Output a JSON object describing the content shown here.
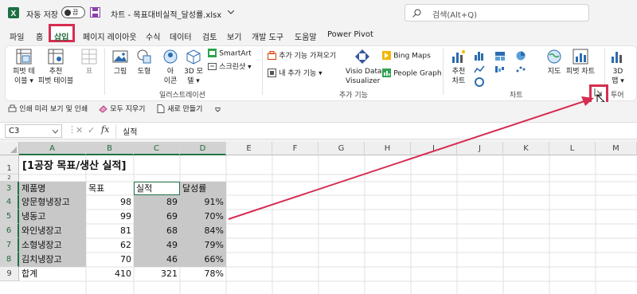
{
  "titlebar": {
    "autosave_label": "자동 저장",
    "autosave_state": "끔",
    "filename": "차트 - 목표대비실적_달성률.xlsx",
    "search_placeholder": "검색(Alt+Q)"
  },
  "menu": [
    "파일",
    "홈",
    "삽입",
    "페이지 레이아웃",
    "수식",
    "데이터",
    "검토",
    "보기",
    "개발 도구",
    "도움말",
    "Power Pivot"
  ],
  "ribbon": {
    "pivot_table": [
      "피벗 테",
      "이블 ▾"
    ],
    "recommended_pivot": [
      "추천",
      "피벗 테이블"
    ],
    "table": "표",
    "picture": "그림",
    "shapes": "도형",
    "icons": [
      "아",
      "이콘"
    ],
    "models3d": [
      "3D 모",
      "델 ▾"
    ],
    "smartart": "SmartArt",
    "screenshot": "스크린샷 ▾",
    "illustrations_group": "일러스트레이션",
    "get_addins": "추가 기능 가져오기",
    "my_addins": "내 추가 기능 ▾",
    "visio": [
      "Visio Data",
      "Visualizer"
    ],
    "bing_maps": "Bing Maps",
    "people_graph": "People Graph",
    "addins_group": "추가 기능",
    "recommended_charts": [
      "추천",
      "차트"
    ],
    "maps": "지도",
    "pivot_chart": "피벗 차트",
    "charts_group": "차트",
    "map3d": [
      "3D",
      "맵 ▾"
    ],
    "tours_group": "투어"
  },
  "qat": {
    "print_preview": "인쇄 미리 보기 및 인쇄",
    "clear_all": "모두 지우기",
    "new": "새로 만들기"
  },
  "formula_bar": {
    "name_box": "C3",
    "fx": "fx",
    "content": "실적"
  },
  "grid": {
    "columns": [
      "A",
      "B",
      "C",
      "D",
      "E",
      "F",
      "G",
      "H",
      "I",
      "J",
      "K",
      "L",
      "M"
    ],
    "rows": [
      "1",
      "2",
      "3",
      "4",
      "5",
      "6",
      "7",
      "8",
      "9"
    ],
    "title": "[1공장 목표/생산 실적]",
    "headers": [
      "제품명",
      "목표",
      "실적",
      "달성률"
    ],
    "data": [
      [
        "양문형냉장고",
        "98",
        "89",
        "91%"
      ],
      [
        "냉동고",
        "99",
        "69",
        "70%"
      ],
      [
        "와인냉장고",
        "81",
        "68",
        "84%"
      ],
      [
        "소형냉장고",
        "62",
        "49",
        "79%"
      ],
      [
        "김치냉장고",
        "70",
        "46",
        "66%"
      ]
    ],
    "total": [
      "합계",
      "410",
      "321",
      "78%"
    ]
  }
}
